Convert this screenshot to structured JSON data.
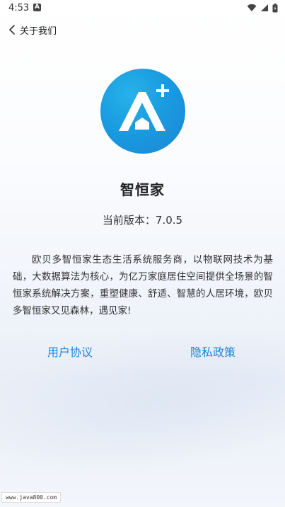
{
  "status_bar": {
    "time": "4:53",
    "notification_badge": "A"
  },
  "nav": {
    "title": "关于我们"
  },
  "app": {
    "name": "智恒家",
    "version_text": "当前版本：7.0.5",
    "description": "欧贝多智恒家生态生活系统服务商，以物联网技术为基础，大数据算法为核心，为亿万家庭居住空间提供全场景的智恒家系统解决方案，重塑健康、舒适、智慧的人居环境，欧贝多智恒家又见森林，遇见家!"
  },
  "links": {
    "user_agreement": "用户协议",
    "privacy_policy": "隐私政策"
  },
  "watermark": {
    "text": "www.java800.com"
  },
  "colors": {
    "link": "#1a87d8",
    "logo_primary": "#1b8fdc"
  }
}
